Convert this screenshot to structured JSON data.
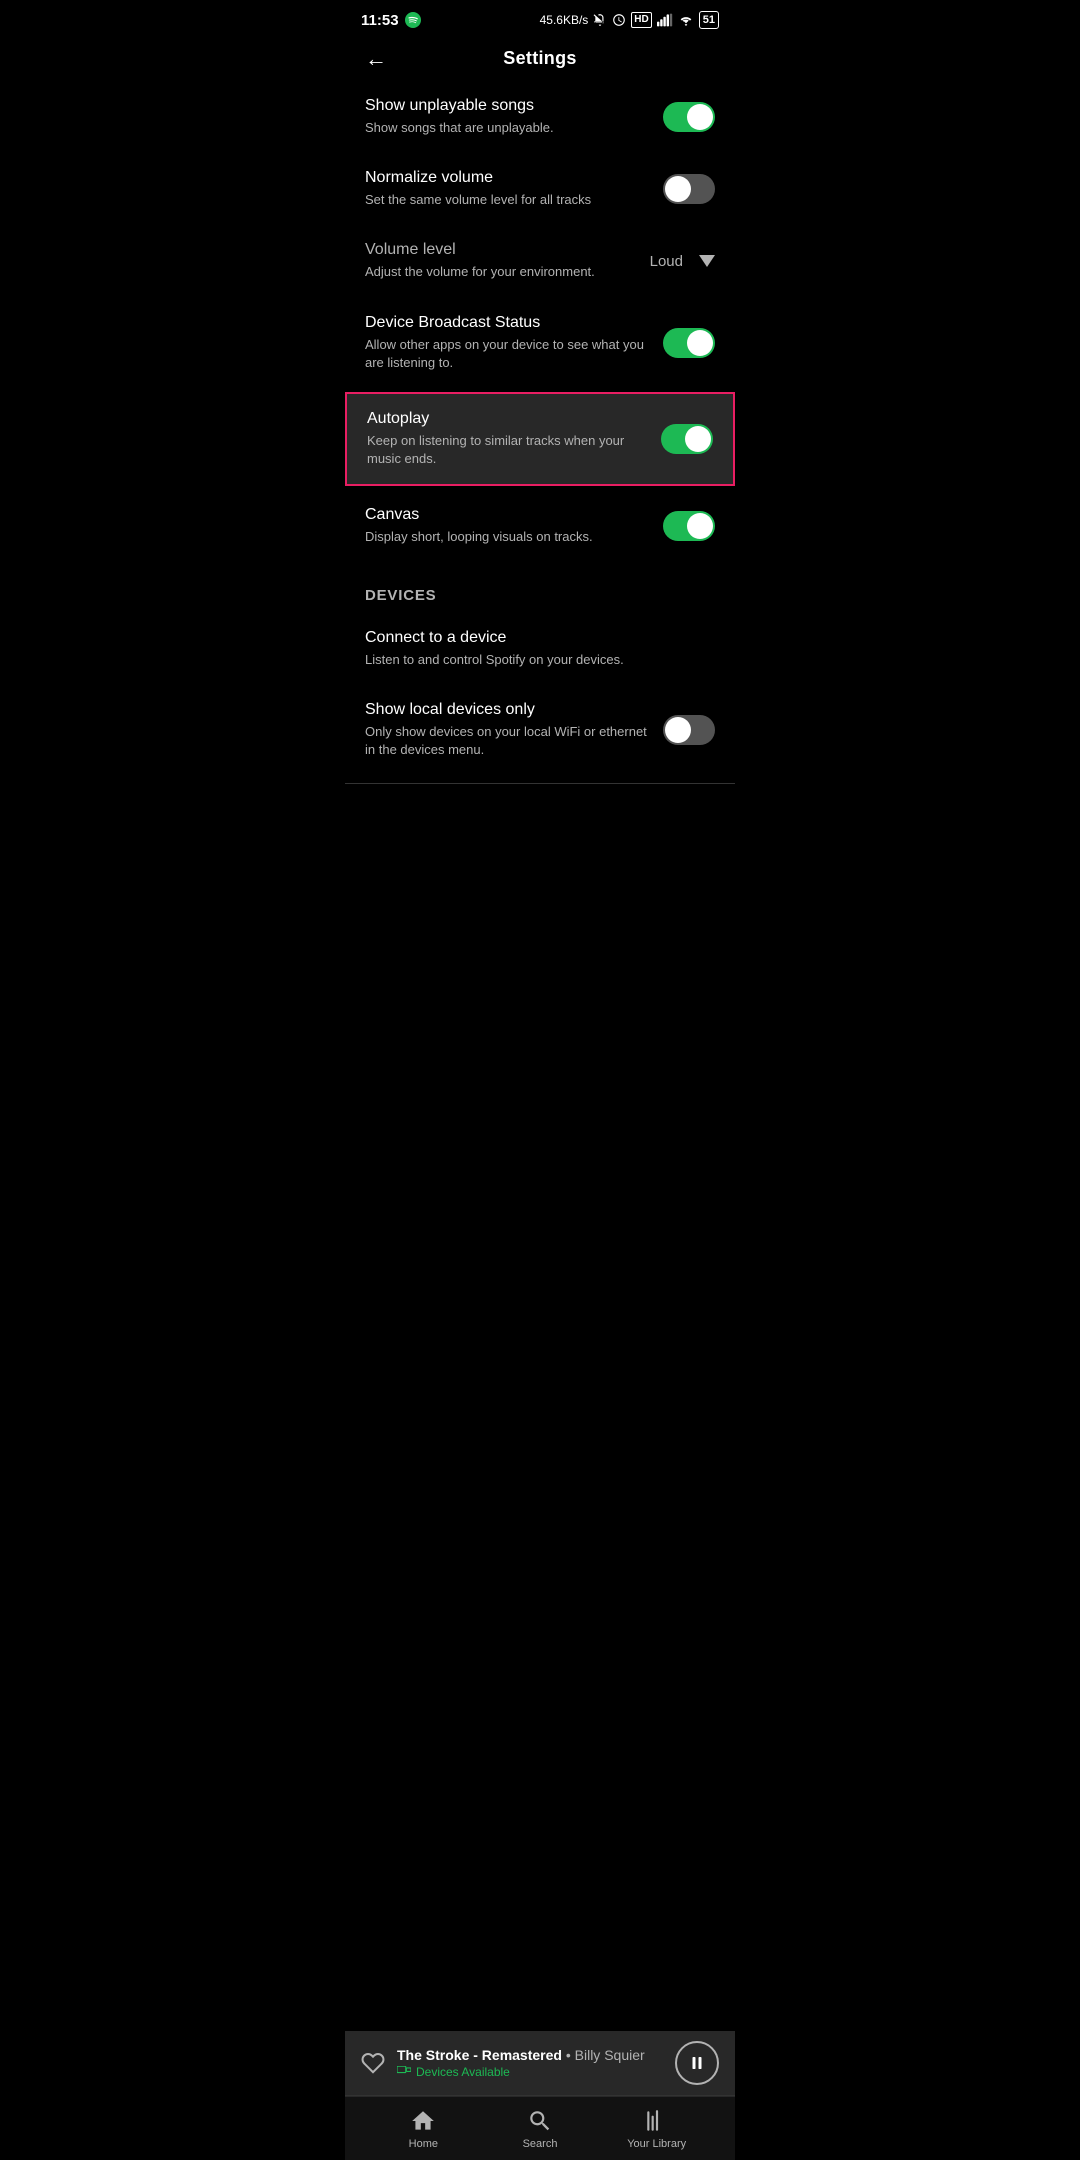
{
  "statusBar": {
    "time": "11:53",
    "network": "45.6KB/s",
    "battery": "51"
  },
  "header": {
    "title": "Settings",
    "backLabel": "←"
  },
  "settings": [
    {
      "id": "show-unplayable",
      "title": "Show unplayable songs",
      "desc": "Show songs that are unplayable.",
      "toggleState": "on",
      "highlighted": false
    },
    {
      "id": "normalize-volume",
      "title": "Normalize volume",
      "desc": "Set the same volume level for all tracks",
      "toggleState": "off",
      "highlighted": false
    },
    {
      "id": "volume-level",
      "title": "Volume level",
      "desc": "Adjust the volume for your environment.",
      "type": "value",
      "value": "Loud",
      "highlighted": false
    },
    {
      "id": "device-broadcast",
      "title": "Device Broadcast Status",
      "desc": "Allow other apps on your device to see what you are listening to.",
      "toggleState": "on",
      "highlighted": false
    },
    {
      "id": "autoplay",
      "title": "Autoplay",
      "desc": "Keep on listening to similar tracks when your music ends.",
      "toggleState": "on",
      "highlighted": true
    },
    {
      "id": "canvas",
      "title": "Canvas",
      "desc": "Display short, looping visuals on tracks.",
      "toggleState": "on",
      "highlighted": false
    }
  ],
  "devicesSection": {
    "header": "Devices",
    "items": [
      {
        "id": "connect-device",
        "title": "Connect to a device",
        "desc": "Listen to and control Spotify on your devices.",
        "type": "link"
      },
      {
        "id": "local-devices",
        "title": "Show local devices only",
        "desc": "Only show devices on your local WiFi or ethernet in the devices menu.",
        "toggleState": "off"
      }
    ]
  },
  "nowPlaying": {
    "track": "The Stroke - Remastered",
    "artist": "Billy Squier",
    "deviceStatus": "Devices Available"
  },
  "bottomNav": [
    {
      "id": "home",
      "label": "Home",
      "icon": "home",
      "active": false
    },
    {
      "id": "search",
      "label": "Search",
      "icon": "search",
      "active": false
    },
    {
      "id": "library",
      "label": "Your Library",
      "icon": "library",
      "active": false
    }
  ]
}
